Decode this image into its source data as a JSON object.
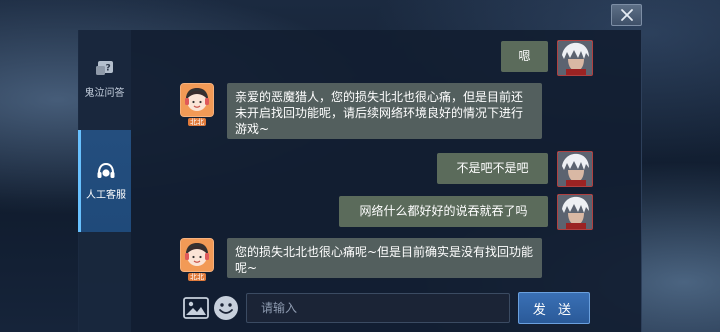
{
  "window": {
    "top_text": "",
    "close_icon": "close-icon"
  },
  "sidebar": {
    "items": [
      {
        "label": "鬼泣问答",
        "icon": "help-question-icon",
        "active": false
      },
      {
        "label": "人工客服",
        "icon": "customer-service-headset-icon",
        "active": true
      }
    ]
  },
  "chat": {
    "messages": [
      {
        "sender": "user",
        "text": "嗯"
      },
      {
        "sender": "agent",
        "text": "亲爱的恶魔猎人，您的损失北北也很心痛，但是目前还未开启找回功能呢，请后续网络环境良好的情况下进行游戏~",
        "tag": "北北"
      },
      {
        "sender": "user",
        "text": "不是吧不是吧"
      },
      {
        "sender": "user",
        "text": "网络什么都好好的说吞就吞了吗"
      },
      {
        "sender": "agent",
        "text": "您的损失北北也很心痛呢~但是目前确实是没有找回功能呢~",
        "tag": "北北"
      }
    ]
  },
  "input": {
    "placeholder": "请输入",
    "value": "",
    "image_icon": "image-icon",
    "emoji_icon": "emoji-icon"
  },
  "send_button": {
    "label": "发 送"
  },
  "colors": {
    "user_bubble": "#5b6b5b",
    "agent_bubble": "#535f5e",
    "active_tab": "#244e7e",
    "send_button": "#3a70b5"
  }
}
